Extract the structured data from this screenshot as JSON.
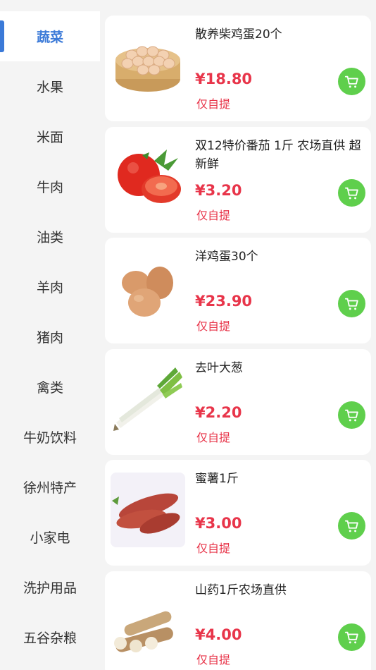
{
  "sidebar": {
    "items": [
      {
        "label": "蔬菜",
        "active": true
      },
      {
        "label": "水果"
      },
      {
        "label": "米面"
      },
      {
        "label": "牛肉"
      },
      {
        "label": "油类"
      },
      {
        "label": "羊肉"
      },
      {
        "label": "猪肉"
      },
      {
        "label": "禽类"
      },
      {
        "label": "牛奶饮料"
      },
      {
        "label": "徐州特产"
      },
      {
        "label": "小家电"
      },
      {
        "label": "洗护用品"
      },
      {
        "label": "五谷杂粮"
      }
    ]
  },
  "products": [
    {
      "title": "散养柴鸡蛋20个",
      "price": "¥18.80",
      "tag": "仅自提",
      "image": "egg-basket"
    },
    {
      "title": "双12特价番茄 1斤 农场直供 超新鲜",
      "price": "¥3.20",
      "tag": "仅自提",
      "image": "tomato"
    },
    {
      "title": "洋鸡蛋30个",
      "price": "¥23.90",
      "tag": "仅自提",
      "image": "eggs"
    },
    {
      "title": "去叶大葱",
      "price": "¥2.20",
      "tag": "仅自提",
      "image": "scallion"
    },
    {
      "title": "蜜薯1斤",
      "price": "¥3.00",
      "tag": "仅自提",
      "image": "sweet-potato"
    },
    {
      "title": "山药1斤农场直供",
      "price": "¥4.00",
      "tag": "仅自提",
      "image": "yam"
    }
  ],
  "colors": {
    "accent": "#3b7ad8",
    "price": "#e8354a",
    "cart": "#5fcf4c"
  },
  "icons": {
    "cart": "cart-icon"
  }
}
